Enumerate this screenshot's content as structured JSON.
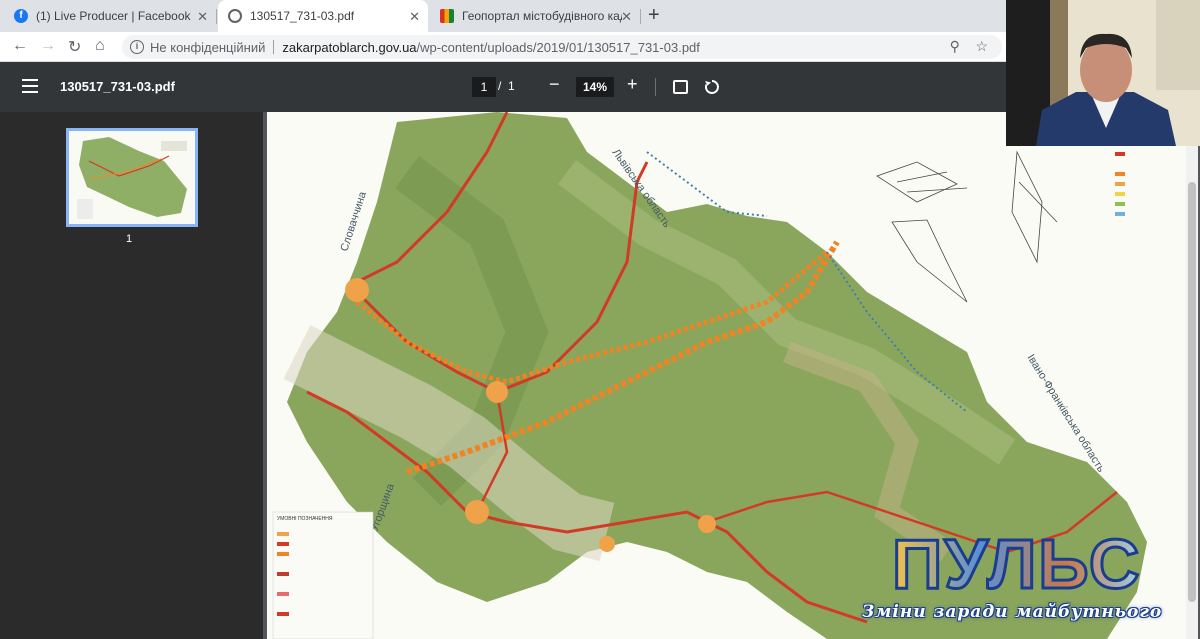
{
  "browser": {
    "tabs": [
      {
        "label": "(1) Live Producer | Facebook",
        "favicon": "facebook-icon",
        "color": "#1877f2"
      },
      {
        "label": "130517_731-03.pdf",
        "favicon": "globe-icon",
        "color": "#5f6368",
        "active": true
      },
      {
        "label": "Геопортал містобудівного када",
        "favicon": "geoportal-icon",
        "color": "#d93025"
      }
    ],
    "address": {
      "not_secure": "Не конфіденційний",
      "host": "zakarpatoblarch.gov.ua",
      "path": "/wp-content/uploads/2019/01/130517_731-03.pdf"
    }
  },
  "pdf": {
    "title": "130517_731-03.pdf",
    "current_page": "1",
    "total_pages": "1",
    "page_separator": "/",
    "zoom": "14%",
    "thumbnail_label": "1"
  },
  "map": {
    "labels": {
      "lviv": "Львівська область",
      "ivano": "Івано-Франківська область",
      "slovakia": "Словаччина",
      "hungary": "Угорщина",
      "legend_title": "УМОВНІ ПОЗНАЧЕННЯ"
    }
  },
  "overlay": {
    "logo": "ПУЛЬС",
    "slogan": "Зміни заради майбутнього"
  }
}
